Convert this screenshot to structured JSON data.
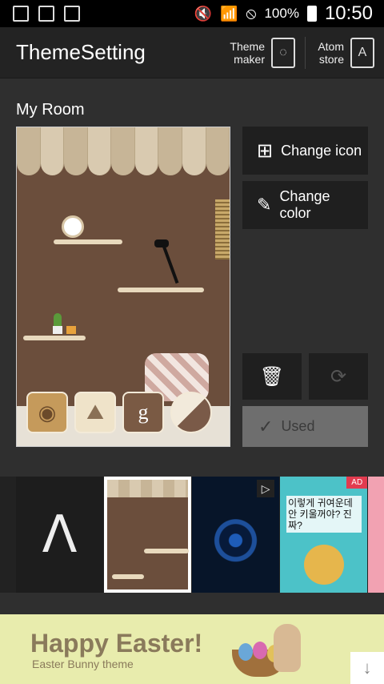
{
  "status_bar": {
    "battery": "100%",
    "time": "10:50",
    "icons": [
      "screenshot-icon",
      "gallery-icon",
      "file-icon",
      "mute-icon",
      "wifi-icon",
      "no-disturb-icon",
      "battery-icon"
    ]
  },
  "app_bar": {
    "title": "ThemeSetting",
    "theme_maker_label": "Theme maker",
    "atom_store_label": "Atom store"
  },
  "main": {
    "section_title": "My Room",
    "change_icon_label": "Change icon",
    "change_color_label": "Change color",
    "used_label": "Used"
  },
  "strip": {
    "ad_badge": "AD",
    "ad_text": "이렇게 귀여운데 안 키울꺼야? 진짜?"
  },
  "banner": {
    "title": "Happy Easter!",
    "subtitle": "Easter Bunny theme"
  }
}
